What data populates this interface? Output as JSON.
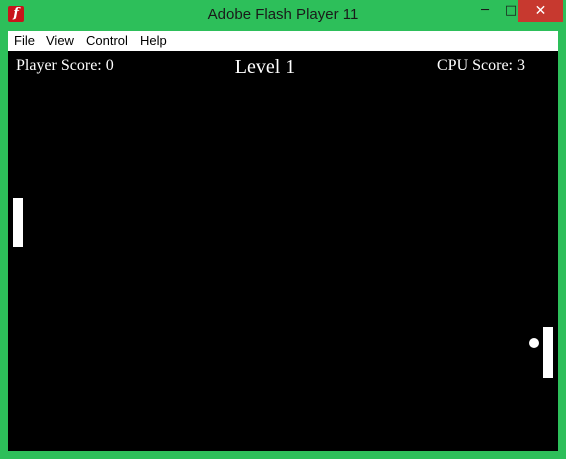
{
  "window": {
    "title": "Adobe Flash Player 11",
    "app_icon": "flash-player-icon",
    "controls": {
      "minimize": "─",
      "maximize": "□",
      "close": "✕"
    },
    "accent_color": "#2dbf5a"
  },
  "menu": {
    "items": [
      "File",
      "View",
      "Control",
      "Help"
    ]
  },
  "game": {
    "player_score_label": "Player Score: 0",
    "level_label": "Level 1",
    "cpu_score_label": "CPU Score: 3",
    "background_color": "#000000"
  }
}
